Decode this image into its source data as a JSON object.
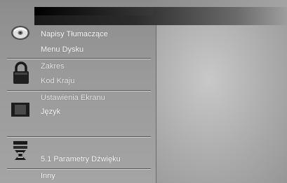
{
  "menu": {
    "items": [
      {
        "label": "Napisy Tłumaczące"
      },
      {
        "label": "Menu Dysku"
      },
      {
        "label": "Zakres"
      },
      {
        "label": "Kod Kraju"
      },
      {
        "label": "Ustawienia Ekranu"
      },
      {
        "label": "Język"
      },
      {
        "label": "5.1 Parametry Dźwięku"
      },
      {
        "label": "Inny"
      }
    ]
  }
}
